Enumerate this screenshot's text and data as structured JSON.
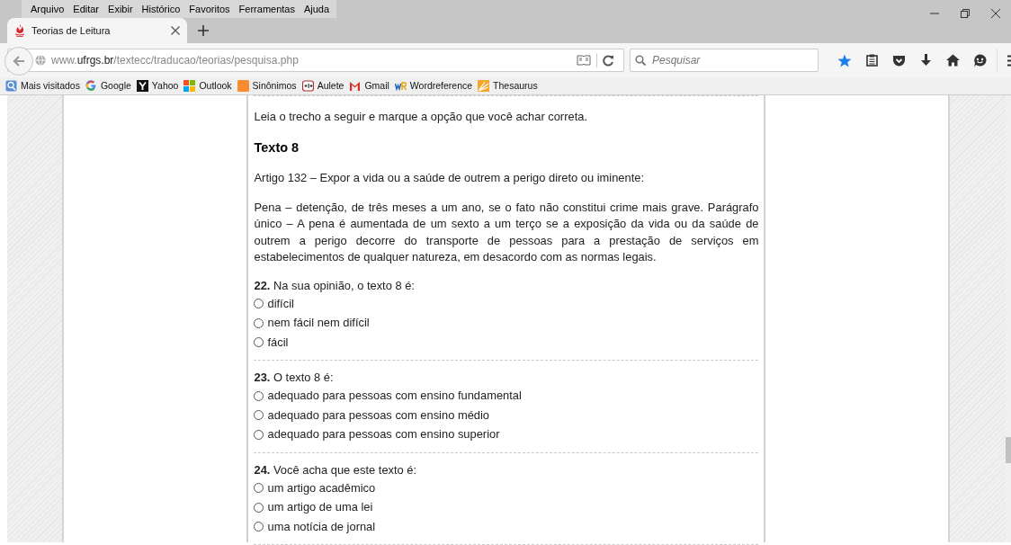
{
  "menu_bar": [
    "Arquivo",
    "Editar",
    "Exibir",
    "Histórico",
    "Favoritos",
    "Ferramentas",
    "Ajuda"
  ],
  "tabs": [
    {
      "title": "Teorias de Leitura",
      "selected": true
    }
  ],
  "address_bar": {
    "prefix": "www.",
    "domain": "ufrgs.br",
    "path": "/textecc/traducao/teorias/pesquisa.php"
  },
  "search": {
    "placeholder": "Pesquisar"
  },
  "bookmarks": [
    {
      "label": "Mais visitados",
      "kind": "folder"
    },
    {
      "label": "Google",
      "kind": "google"
    },
    {
      "label": "Yahoo",
      "kind": "yahoo"
    },
    {
      "label": "Outlook",
      "kind": "outlook"
    },
    {
      "label": "Sinônimos",
      "kind": "orange"
    },
    {
      "label": "Aulete",
      "kind": "dict"
    },
    {
      "label": "Gmail",
      "kind": "gmail"
    },
    {
      "label": "Wordreference",
      "kind": "wr"
    },
    {
      "label": "Thesaurus",
      "kind": "thesaurus"
    }
  ],
  "page": {
    "instruction": "Leia o trecho a seguir e marque a opção que você achar correta.",
    "heading": "Texto 8",
    "paragraphs": [
      "Artigo 132 – Expor a vida ou a saúde de outrem a perigo direto ou iminente:",
      "Pena – detenção, de três meses a um ano, se o fato não constitui crime mais grave. Parágrafo único – A pena é aumentada de um sexto a um terço se a exposição da vida ou da saúde de outrem a perigo decorre do transporte de pessoas para a prestação de serviços em estabelecimentos de qualquer natureza, em desacordo com as normas legais."
    ],
    "questions": [
      {
        "prompt": "**22.** Na sua opinião, o texto 8 é:",
        "options": [
          {
            "label": "difícil",
            "selected": false
          },
          {
            "label": "nem fácil nem difícil",
            "selected": false
          },
          {
            "label": "fácil",
            "selected": false
          }
        ]
      },
      {
        "prompt": "**23.** O texto 8 é:",
        "options": [
          {
            "label": "adequado para pessoas com ensino fundamental",
            "selected": false
          },
          {
            "label": "adequado para pessoas com ensino médio",
            "selected": false
          },
          {
            "label": "adequado para pessoas com ensino superior",
            "selected": false
          }
        ]
      },
      {
        "prompt": "**24.** Você acha que este texto é:",
        "options": [
          {
            "label": "um artigo acadêmico",
            "selected": false
          },
          {
            "label": "um artigo de uma lei",
            "selected": false
          },
          {
            "label": "uma notícia de jornal",
            "selected": false
          }
        ]
      }
    ]
  }
}
